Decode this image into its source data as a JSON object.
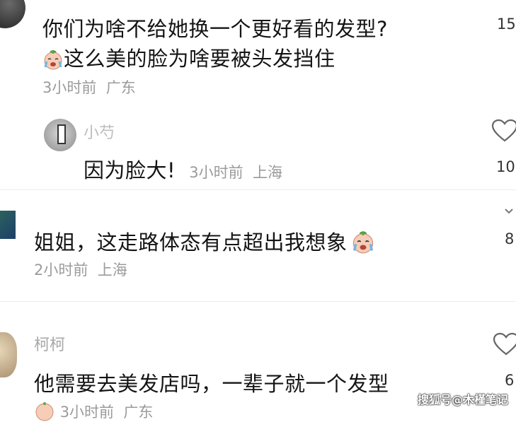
{
  "comments": [
    {
      "line1": "你们为啥不给她换一个更好看的发型?",
      "line2": "这么美的脸为啥要被头发挡住",
      "time": "3小时前",
      "location": "广东",
      "likes": "15"
    },
    {
      "username": "小芍",
      "text": "因为脸大!",
      "time": "3小时前",
      "location": "上海",
      "likes": "10"
    },
    {
      "text": "姐姐，这走路体态有点超出我想象",
      "time": "2小时前",
      "location": "上海",
      "likes": "8"
    },
    {
      "username": "柯柯",
      "text": "他需要去美发店吗，一辈子就一个发型",
      "time": "3小时前",
      "location": "广东",
      "likes": "6"
    }
  ],
  "watermark": "搜狐号@木槿笔记",
  "icons": {
    "emoji": "crying-face-emoji",
    "like": "heart-outline-icon",
    "expand": "chevron-down-icon"
  }
}
